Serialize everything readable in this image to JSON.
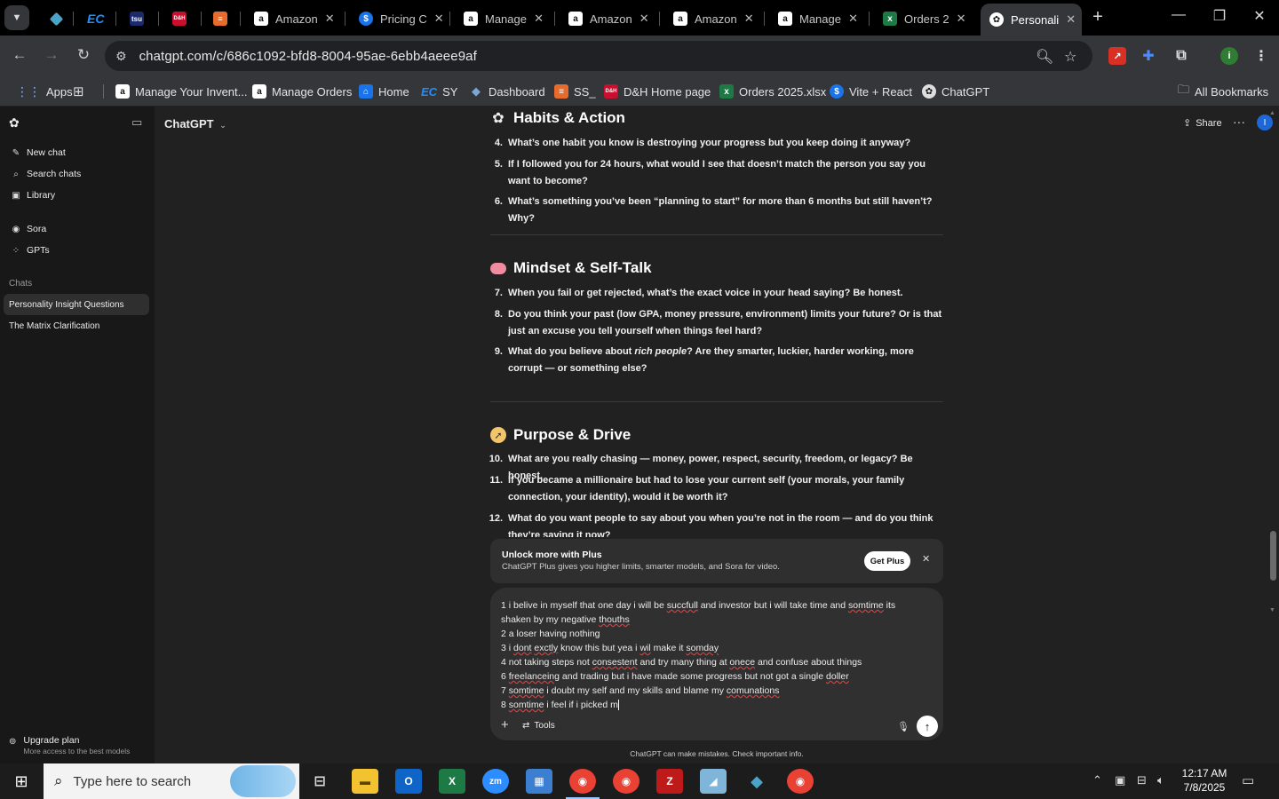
{
  "tabs": [
    {
      "favicon": "chevron-down-icon",
      "title": ""
    },
    {
      "favicon": "app-icon",
      "title": ""
    },
    {
      "favicon": "EC",
      "title": ""
    },
    {
      "favicon": "tsu",
      "title": ""
    },
    {
      "favicon": "D&H",
      "title": ""
    },
    {
      "favicon": "stack",
      "title": ""
    },
    {
      "favicon": "amazon",
      "title": "Amazon"
    },
    {
      "favicon": "dollar",
      "title": "Pricing C"
    },
    {
      "favicon": "amazon",
      "title": "Manage"
    },
    {
      "favicon": "amazon",
      "title": "Amazon"
    },
    {
      "favicon": "amazon",
      "title": "Amazon"
    },
    {
      "favicon": "amazon",
      "title": "Manage"
    },
    {
      "favicon": "excel",
      "title": "Orders 2"
    },
    {
      "favicon": "chatgpt",
      "title": "Personali"
    }
  ],
  "url": "chatgpt.com/c/686c1092-bfd8-8004-95ae-6ebb4aeee9af",
  "bookmarks": [
    "Apps",
    "Manage Your Invent...",
    "Manage Orders",
    "Home",
    "SY",
    "Dashboard",
    "SS_",
    "D&H Home page",
    "Orders 2025.xlsx",
    "Vite + React",
    "ChatGPT"
  ],
  "all_bookmarks": "All Bookmarks",
  "sidebar": {
    "nav": [
      "New chat",
      "Search chats",
      "Library"
    ],
    "nav2": [
      "Sora",
      "GPTs"
    ],
    "chats_label": "Chats",
    "chats": [
      "Personality Insight Questions",
      "The Matrix Clarification"
    ],
    "upgrade_title": "Upgrade plan",
    "upgrade_sub": "More access to the best models"
  },
  "header": {
    "model": "ChatGPT",
    "share": "Share",
    "avatar": "I"
  },
  "sections": [
    {
      "title": "Habits & Action"
    },
    {
      "title": "Mindset & Self-Talk"
    },
    {
      "title": "Purpose & Drive"
    }
  ],
  "questions": [
    {
      "n": "4.",
      "text": "What’s one habit you know is destroying your progress but you keep doing it anyway?"
    },
    {
      "n": "5.",
      "text": "If I followed you for 24 hours, what would I see that doesn’t match the person you say you want to become?"
    },
    {
      "n": "6.",
      "text": "What’s something you’ve been “planning to start” for more than 6 months but still haven’t? Why?"
    },
    {
      "n": "7.",
      "text": "When you fail or get rejected, what’s the exact voice in your head saying? Be honest."
    },
    {
      "n": "8.",
      "text": "Do you think your past (low GPA, money pressure, environment) limits your future? Or is that just an excuse you tell yourself when things feel hard?"
    },
    {
      "n": "9.",
      "text_before": "What do you believe about ",
      "text_italic": "rich people",
      "text_after": "? Are they smarter, luckier, harder working, more corrupt — or something else?"
    },
    {
      "n": "10.",
      "text": "What are you really chasing — money, power, respect, security, freedom, or legacy? Be honest."
    },
    {
      "n": "11.",
      "text": "If you became a millionaire but had to lose your current self (your morals, your family connection, your identity), would it be worth it?"
    },
    {
      "n": "12.",
      "text": "What do you want people to say about you when you’re not in the room — and do you think they’re saving it now?"
    }
  ],
  "plus_banner": {
    "title": "Unlock more with Plus",
    "subtitle": "ChatGPT Plus gives you higher limits, smarter models, and Sora for video.",
    "button": "Get Plus"
  },
  "composer": {
    "lines": [
      "1 i belive in myself that one day i will be succfull  and investor  but i will take time and somtime its",
      "shaken by my negative thouths",
      "2   a loser having nothing",
      "3    i dont exctly know this but yea i wil make it somday",
      "4    not taking steps not consestent and try many thing at onece  and confuse about things",
      "6    freelanceing and trading  but i have made some progress but not got a single doller",
      "7    somtime i doubt my self and my skills  and blame my comunations",
      "8   somtime i feel if i picked m"
    ],
    "tools": "Tools"
  },
  "disclaimer": "ChatGPT can make mistakes. Check important info.",
  "taskbar": {
    "search_placeholder": "Type here to search",
    "time": "12:17 AM",
    "date": "7/8/2025"
  }
}
